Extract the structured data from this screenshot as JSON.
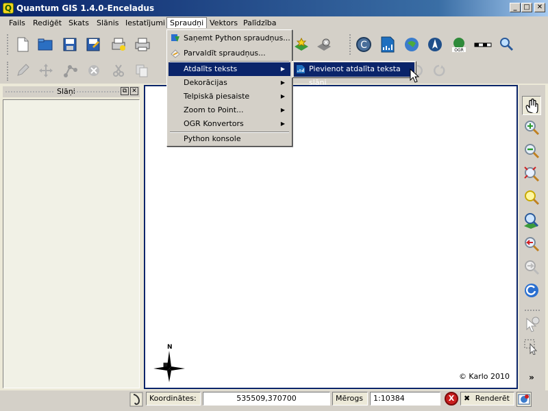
{
  "window": {
    "title": "Quantum GIS 1.4.0-Enceladus",
    "app_icon_letter": "Q",
    "controls": [
      "_",
      "□",
      "✕"
    ]
  },
  "menubar": {
    "items": [
      "Fails",
      "Rediģēt",
      "Skats",
      "Slānis",
      "Iestatījumi",
      "Spraudņi",
      "Vektors",
      "Palīdzība"
    ],
    "active": "Spraudņi"
  },
  "plugins_menu": {
    "items": [
      {
        "label": "Saņemt Python spraudņus...",
        "icon": "python-download-icon",
        "submenu": false
      },
      {
        "label": "Parvaldīt spraudņus...",
        "icon": "plugin-manager-icon",
        "submenu": false
      },
      {
        "label": "Atdalīts teksts",
        "icon": "",
        "submenu": true,
        "highlighted": true
      },
      {
        "label": "Dekorācijas",
        "icon": "",
        "submenu": true
      },
      {
        "label": "Telpiskā piesaiste",
        "icon": "",
        "submenu": true
      },
      {
        "label": "Zoom to Point...",
        "icon": "",
        "submenu": true
      },
      {
        "label": "OGR Konvertors",
        "icon": "",
        "submenu": true
      },
      {
        "label": "Python konsole",
        "icon": "",
        "submenu": false
      }
    ],
    "submenu_arrow": "▶"
  },
  "submenu": {
    "item": "Pievienot atdalīta teksta slāni",
    "icon": "delimited-text-icon"
  },
  "layers_panel": {
    "title": "Slāņi",
    "float_label": "⧉",
    "close_label": "✕"
  },
  "map": {
    "credit": "© Karlo 2010",
    "north_label": "N"
  },
  "statusbar": {
    "coords_label": "Koordinātes:",
    "coords_value": "535509,370700",
    "scale_label": "Mērogs",
    "scale_value": "1:10384",
    "render_label": "Renderēt",
    "stop_symbol": "X",
    "render_check": "✖"
  },
  "rtoolbar": {
    "more_symbol": "»"
  },
  "colors": {
    "titlebar": "#0a246a",
    "highlight": "#0a246a",
    "chrome": "#d4d0c8",
    "panel_bg": "#f1f1e6"
  }
}
